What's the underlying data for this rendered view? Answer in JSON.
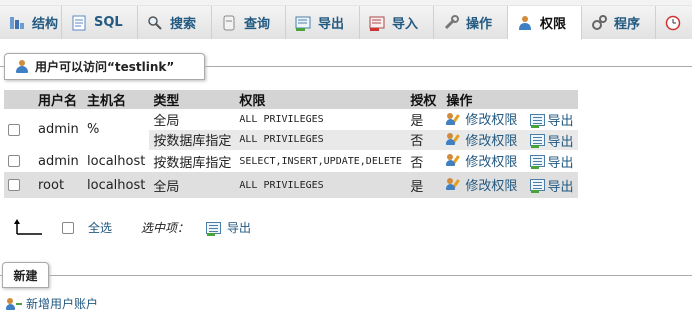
{
  "tabs": [
    {
      "label": "结构",
      "icon": "structure-icon"
    },
    {
      "label": "SQL",
      "icon": "sql-icon"
    },
    {
      "label": "搜索",
      "icon": "search-icon"
    },
    {
      "label": "查询",
      "icon": "query-icon"
    },
    {
      "label": "导出",
      "icon": "export-icon"
    },
    {
      "label": "导入",
      "icon": "import-icon"
    },
    {
      "label": "操作",
      "icon": "wrench-icon"
    },
    {
      "label": "权限",
      "icon": "user-icon"
    },
    {
      "label": "程序",
      "icon": "gears-icon"
    },
    {
      "label": "",
      "icon": "clock-icon"
    }
  ],
  "active_tab": "权限",
  "section": {
    "title_prefix": "用户可以访问",
    "title_db": "“testlink”"
  },
  "table": {
    "headers": [
      "用户名",
      "主机名",
      "类型",
      "权限",
      "授权",
      "操作"
    ],
    "rows": [
      {
        "user": "admin",
        "host": "%",
        "type": "全局",
        "privileges": "ALL PRIVILEGES",
        "grant": "是",
        "edit": "修改权限",
        "export": "导出"
      },
      {
        "user": "",
        "host": "",
        "type": "按数据库指定",
        "privileges": "ALL PRIVILEGES",
        "grant": "否",
        "edit": "修改权限",
        "export": "导出"
      },
      {
        "user": "admin",
        "host": "localhost",
        "type": "按数据库指定",
        "privileges": "SELECT,INSERT,UPDATE,DELETE",
        "grant": "否",
        "edit": "修改权限",
        "export": "导出"
      },
      {
        "user": "root",
        "host": "localhost",
        "type": "全局",
        "privileges": "ALL PRIVILEGES",
        "grant": "是",
        "edit": "修改权限",
        "export": "导出"
      }
    ]
  },
  "bulk": {
    "select_all": "全选",
    "with_selected": "选中项：",
    "export": "导出"
  },
  "new_section": {
    "title": "新建",
    "add_user": "新增用户账户"
  }
}
